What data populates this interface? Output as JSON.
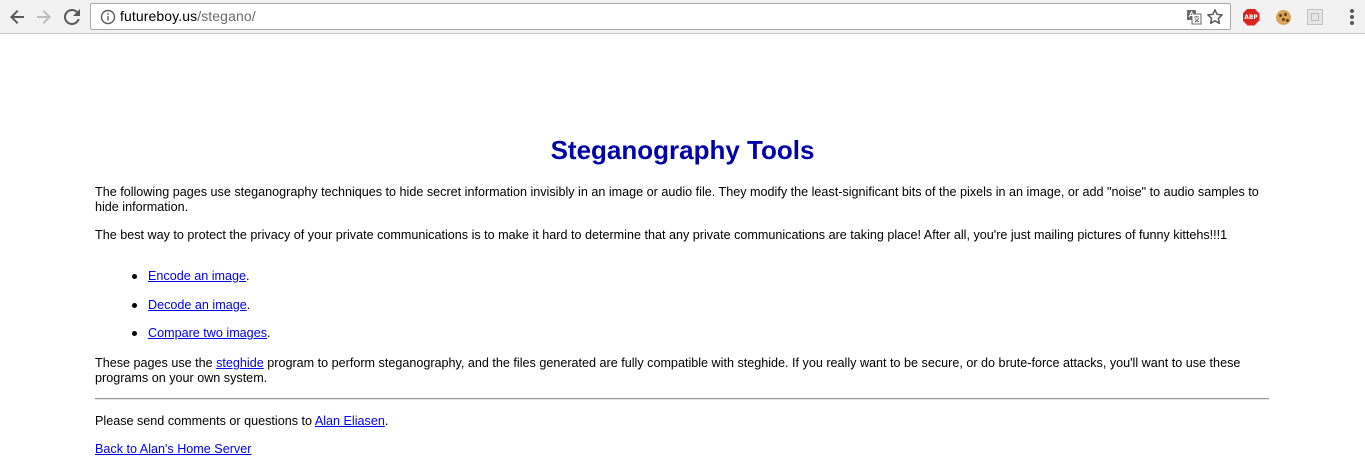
{
  "browser": {
    "url_host": "futureboy.us",
    "url_path": "/stegano/",
    "extensions": [
      "adblock-plus-icon",
      "cookie-icon",
      "extension-icon"
    ],
    "abp_label": "ABP"
  },
  "page": {
    "title": "Steganography Tools",
    "intro": "The following pages use steganography techniques to hide secret information invisibly in an image or audio file. They modify the least-significant bits of the pixels in an image, or add \"noise\" to audio samples to hide information.",
    "privacy": "The best way to protect the privacy of your private communications is to make it hard to determine that any private communications are taking place! After all, you're just mailing pictures of funny kittehs!!!1",
    "links": [
      {
        "label": "Encode an image",
        "suffix": "."
      },
      {
        "label": "Decode an image",
        "suffix": "."
      },
      {
        "label": "Compare two images",
        "suffix": "."
      }
    ],
    "steghide": {
      "before": "These pages use the ",
      "link": "steghide",
      "after": " program to perform steganography, and the files generated are fully compatible with steghide. If you really want to be secure, or do brute-force attacks, you'll want to use these programs on your own system."
    },
    "contact": {
      "before": "Please send comments or questions to ",
      "link": "Alan Eliasen",
      "after": "."
    },
    "back_link": "Back to Alan's Home Server"
  },
  "colors": {
    "title": "#0000aa",
    "link": "#0000ee",
    "toolbar": "#f2f2f2"
  }
}
